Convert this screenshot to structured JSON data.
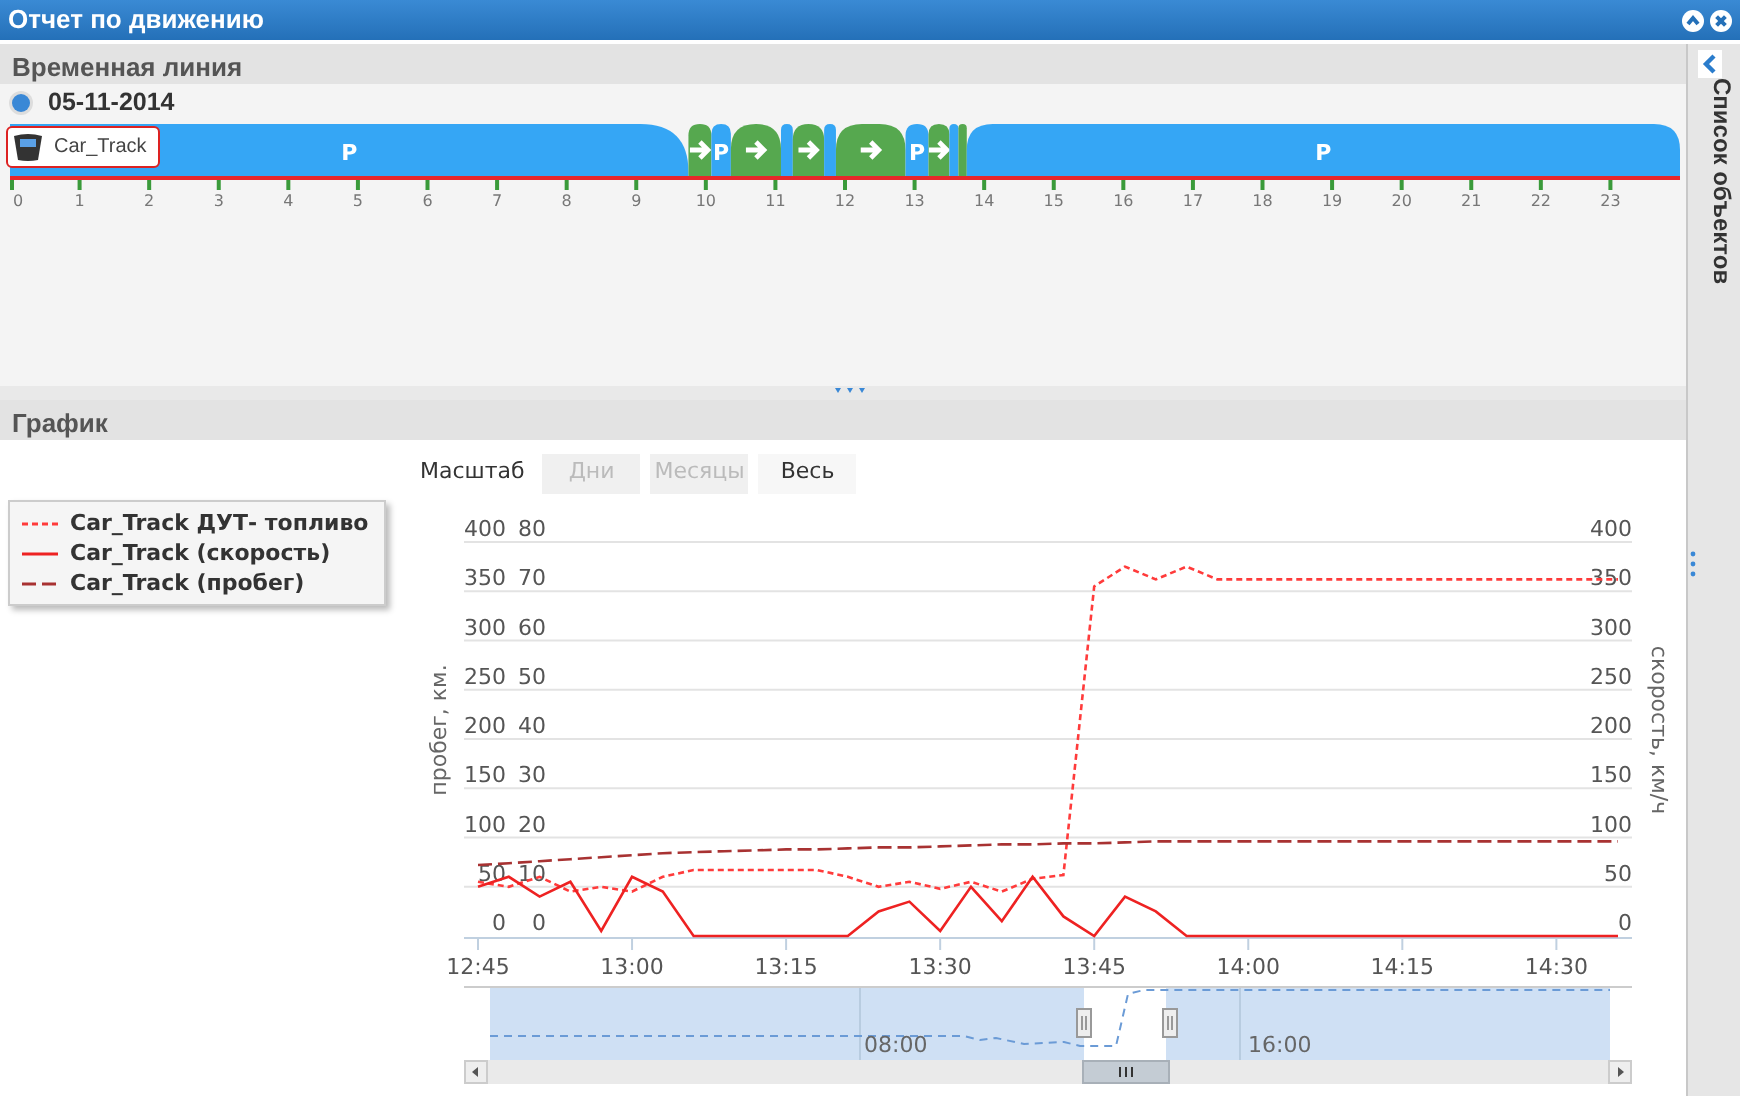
{
  "window": {
    "title": "Отчет по движению"
  },
  "timeline": {
    "title": "Временная линия",
    "date": "05-11-2014",
    "chart_data": {
      "type": "bar",
      "orientation": "horizontal",
      "stacked": true,
      "categories": [
        "Car_Track"
      ],
      "xlim": [
        0,
        24
      ],
      "xticks": [
        0,
        1,
        2,
        3,
        4,
        5,
        6,
        7,
        8,
        9,
        10,
        11,
        12,
        13,
        14,
        15,
        16,
        17,
        18,
        19,
        20,
        21,
        22,
        23
      ],
      "series": [
        {
          "name": "P",
          "color": "#35a6f5",
          "values": [
            9.75
          ]
        },
        {
          "color": "#56a84f",
          "values": [
            0.33
          ]
        },
        {
          "name": "P",
          "color": "#35a6f5",
          "values": [
            0.28
          ]
        },
        {
          "color": "#56a84f",
          "values": [
            0.72
          ]
        },
        {
          "color": "#35a6f5",
          "values": [
            0.17
          ]
        },
        {
          "color": "#56a84f",
          "values": [
            0.45
          ]
        },
        {
          "color": "#35a6f5",
          "values": [
            0.17
          ]
        },
        {
          "color": "#56a84f",
          "values": [
            1.0
          ]
        },
        {
          "name": "P",
          "color": "#35a6f5",
          "values": [
            0.33
          ]
        },
        {
          "color": "#56a84f",
          "values": [
            0.3
          ]
        },
        {
          "color": "#35a6f5",
          "values": [
            0.13
          ]
        },
        {
          "color": "#56a84f",
          "values": [
            0.12
          ]
        },
        {
          "name": "P",
          "color": "#35a6f5",
          "values": [
            10.25
          ]
        }
      ]
    }
  },
  "sidebar": {
    "title": "Список объектов"
  },
  "chart_panel": {
    "title": "График",
    "range_selector": {
      "label": "Масштаб",
      "buttons": [
        {
          "label": "Дни",
          "disabled": true
        },
        {
          "label": "Месяцы",
          "disabled": true
        },
        {
          "label": "Весь",
          "disabled": false
        }
      ]
    },
    "chart_data": {
      "type": "line",
      "grid": true,
      "ylabel": "пробег, км.",
      "y2label": "скорость, км/ч",
      "ylim": [
        0,
        400
      ],
      "y2lim": [
        0,
        400
      ],
      "categories": [
        "12:45",
        null,
        null,
        null,
        null,
        "13:00",
        null,
        null,
        null,
        null,
        "13:15",
        null,
        null,
        null,
        null,
        "13:30",
        null,
        null,
        null,
        null,
        "13:45",
        null,
        null,
        null,
        null,
        "14:00",
        null,
        null,
        null,
        null,
        "14:15",
        null,
        null,
        null,
        null,
        "14:30",
        null,
        null
      ],
      "yticks": [
        400,
        350,
        300,
        250,
        200,
        150,
        100,
        50,
        0
      ],
      "y2ticks": [
        400,
        350,
        300,
        250,
        200,
        150,
        100,
        50,
        0
      ],
      "annotations": [
        "80",
        "70",
        "60",
        "50",
        "40",
        "30",
        "20",
        "10",
        "0"
      ],
      "series": [
        {
          "name": "Car_Track ДУТ- топливо",
          "color": "#ff3b3b",
          "line_style": "dotted",
          "values": [
            55,
            50,
            60,
            45,
            50,
            45,
            60,
            67,
            67,
            67,
            67,
            67,
            60,
            50,
            55,
            48,
            55,
            45,
            58,
            62,
            355,
            375,
            362,
            375,
            362,
            362,
            362,
            362,
            362,
            362,
            362,
            362,
            362,
            362,
            362,
            362,
            362,
            362
          ]
        },
        {
          "name": "Car_Track (скорость)",
          "color": "#ee2222",
          "line_style": "solid",
          "values": [
            50,
            60,
            40,
            55,
            5,
            60,
            45,
            0,
            0,
            0,
            0,
            0,
            0,
            25,
            35,
            5,
            50,
            15,
            60,
            20,
            0,
            40,
            25,
            0,
            0,
            0,
            0,
            0,
            0,
            0,
            0,
            0,
            0,
            0,
            0,
            0,
            0,
            0
          ]
        },
        {
          "name": "Car_Track (пробег)",
          "color": "#a83232",
          "line_style": "dashed",
          "values": [
            72,
            74,
            76,
            78,
            80,
            82,
            84,
            85,
            86,
            87,
            88,
            88,
            89,
            90,
            90,
            91,
            92,
            93,
            93,
            94,
            94,
            95,
            96,
            96,
            96,
            96,
            96,
            96,
            96,
            96,
            96,
            96,
            96,
            96,
            96,
            96,
            96,
            96
          ]
        }
      ]
    },
    "navigator": {
      "labels": [
        "08:00",
        "16:00"
      ]
    }
  }
}
